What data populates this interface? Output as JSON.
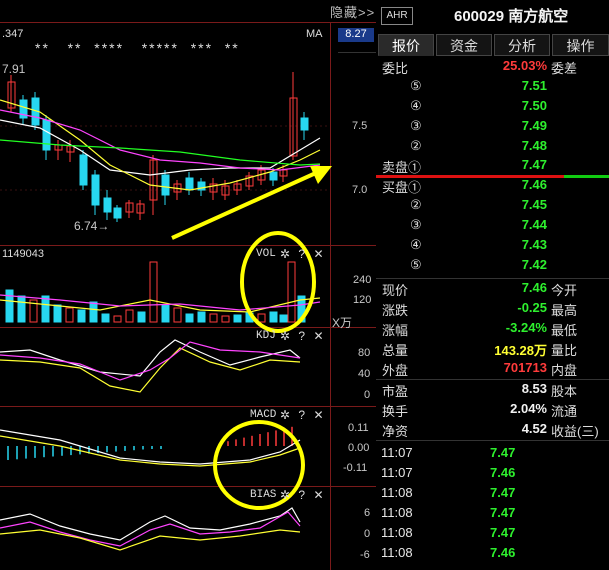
{
  "chart": {
    "hide_label": "隐藏>>",
    "top_left_value": ".347",
    "ma_label": "MA",
    "price_axis_top": "8.27",
    "price_ticks": [
      "7.5",
      "7.0"
    ],
    "high_label": "7.91",
    "low_label": "6.74→",
    "star_marks": "**   **  ****   *****  ***  **",
    "vol_value": "1149043",
    "vol_name": "VOL",
    "vol_ticks": [
      "240",
      "120"
    ],
    "vol_unit": "X万",
    "kdj_name": "KDJ",
    "kdj_ticks": [
      "80",
      "40",
      "0"
    ],
    "macd_name": "MACD",
    "macd_ticks": [
      "0.11",
      "0.00",
      "-0.11"
    ],
    "bias_name": "BIAS",
    "bias_ticks": [
      "6",
      "0",
      "-6"
    ],
    "icon_glyphs": {
      "gear": "✲",
      "help": "?",
      "close": "✕"
    },
    "colors": {
      "up": "#ff3b3b",
      "down": "#27d7f0",
      "ma5": "#ffffff",
      "ma10": "#ffff33",
      "ma20": "#ff44ff",
      "ma60": "#22ff22",
      "highlight": "#ffff00"
    }
  },
  "quote": {
    "badge": "AHR",
    "code": "600029 南方航空",
    "tabs": [
      "报价",
      "资金",
      "分析",
      "操作"
    ],
    "wei_bi_label": "委比",
    "wei_bi_value": "25.03%",
    "wei_cha_label": "委差",
    "sell_side_label": "卖盘①",
    "buy_side_label": "买盘①",
    "sell_levels": [
      {
        "circ": "⑤",
        "price": "7.51"
      },
      {
        "circ": "④",
        "price": "7.50"
      },
      {
        "circ": "③",
        "price": "7.49"
      },
      {
        "circ": "②",
        "price": "7.48"
      },
      {
        "circ": "",
        "price": "7.47"
      }
    ],
    "buy_levels": [
      {
        "circ": "",
        "price": "7.46"
      },
      {
        "circ": "②",
        "price": "7.45"
      },
      {
        "circ": "③",
        "price": "7.44"
      },
      {
        "circ": "④",
        "price": "7.43"
      },
      {
        "circ": "⑤",
        "price": "7.42"
      }
    ],
    "stats": [
      {
        "l": "现价",
        "v": "7.46",
        "vc": "green",
        "r": "今开"
      },
      {
        "l": "涨跌",
        "v": "-0.25",
        "vc": "green",
        "r": "最高"
      },
      {
        "l": "涨幅",
        "v": "-3.24%",
        "vc": "green",
        "r": "最低"
      },
      {
        "l": "总量",
        "v": "143.28万",
        "vc": "yellow",
        "r": "量比"
      },
      {
        "l": "外盘",
        "v": "701713",
        "vc": "red",
        "r": "内盘"
      },
      {
        "l": "市盈",
        "v": "8.53",
        "vc": "white",
        "r": "股本"
      },
      {
        "l": "换手",
        "v": "2.04%",
        "vc": "white",
        "r": "流通"
      },
      {
        "l": "净资",
        "v": "4.52",
        "vc": "white",
        "r": "收益(三)"
      }
    ],
    "trades": [
      {
        "time": "11:07",
        "price": "7.47"
      },
      {
        "time": "11:07",
        "price": "7.46"
      },
      {
        "time": "11:08",
        "price": "7.47"
      },
      {
        "time": "11:08",
        "price": "7.47"
      },
      {
        "time": "11:08",
        "price": "7.47"
      },
      {
        "time": "11:08",
        "price": "7.46"
      }
    ]
  }
}
